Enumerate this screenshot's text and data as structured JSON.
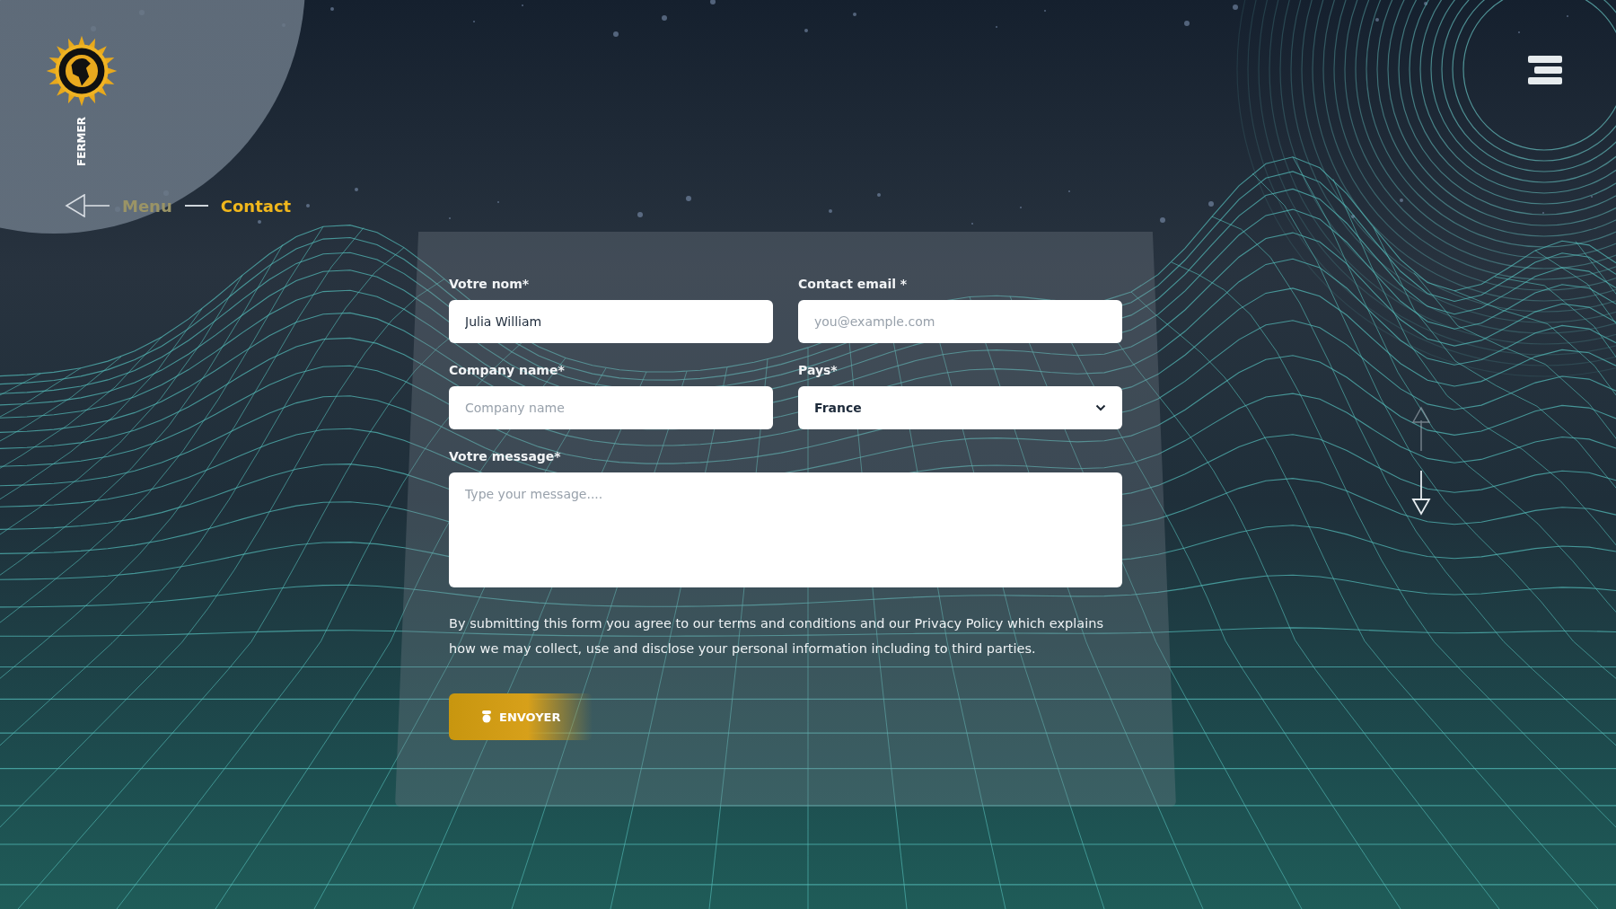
{
  "close_label": "FERMER",
  "breadcrumb": [
    {
      "label": "Menu",
      "current": false
    },
    {
      "label": "Contact",
      "current": true
    }
  ],
  "form": {
    "fields": [
      {
        "kind": "text",
        "label": "Votre nom*",
        "value": "Julia William"
      },
      {
        "kind": "email",
        "label": "Contact email *",
        "placeholder": "you@example.com"
      },
      {
        "kind": "text",
        "label": "Company name*",
        "placeholder": "Company name"
      },
      {
        "kind": "select",
        "label": "Pays*",
        "value": "France"
      },
      {
        "kind": "textarea",
        "label": "Votre message*",
        "placeholder": "Type your message...."
      }
    ],
    "disclaimer": "By submitting this form you agree to our terms and conditions and our Privacy Policy which explains how we may collect, use and disclose your personal information including to third parties.",
    "submit": "ENVOYER"
  }
}
